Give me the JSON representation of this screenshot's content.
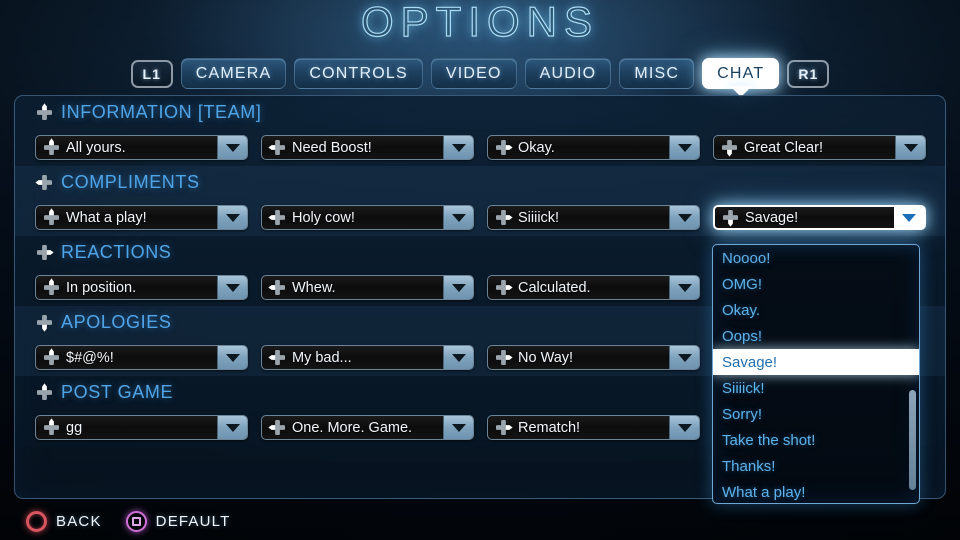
{
  "title": "OPTIONS",
  "tabbar": {
    "left_bumper": "L1",
    "right_bumper": "R1",
    "tabs": [
      {
        "label": "CAMERA",
        "active": false
      },
      {
        "label": "CONTROLS",
        "active": false
      },
      {
        "label": "VIDEO",
        "active": false
      },
      {
        "label": "AUDIO",
        "active": false
      },
      {
        "label": "MISC",
        "active": false
      },
      {
        "label": "CHAT",
        "active": true
      }
    ]
  },
  "colors": {
    "accent_blue": "#4fa5e8",
    "option_text": "#5fb3ec",
    "highlight_white": "#ffffff",
    "back_button": "#d9555f",
    "default_button": "#d070d8"
  },
  "sections": [
    {
      "title": "INFORMATION [TEAM]",
      "dpad": "dpad-up-icon",
      "items": [
        {
          "value": "All yours.",
          "dpad": "dpad-up-icon"
        },
        {
          "value": "Need Boost!",
          "dpad": "dpad-left-icon"
        },
        {
          "value": "Okay.",
          "dpad": "dpad-right-icon"
        },
        {
          "value": "Great Clear!",
          "dpad": "dpad-down-icon"
        }
      ]
    },
    {
      "title": "COMPLIMENTS",
      "dpad": "dpad-left-icon",
      "items": [
        {
          "value": "What a play!",
          "dpad": "dpad-up-icon"
        },
        {
          "value": "Holy cow!",
          "dpad": "dpad-left-icon"
        },
        {
          "value": "Siiiick!",
          "dpad": "dpad-right-icon"
        },
        {
          "value": "Savage!",
          "dpad": "dpad-down-icon",
          "focused": true
        }
      ]
    },
    {
      "title": "REACTIONS",
      "dpad": "dpad-right-icon",
      "items": [
        {
          "value": "In position.",
          "dpad": "dpad-up-icon"
        },
        {
          "value": "Whew.",
          "dpad": "dpad-left-icon"
        },
        {
          "value": "Calculated.",
          "dpad": "dpad-right-icon"
        }
      ]
    },
    {
      "title": "APOLOGIES",
      "dpad": "dpad-down-icon",
      "items": [
        {
          "value": "$#@%!",
          "dpad": "dpad-up-icon"
        },
        {
          "value": "My bad...",
          "dpad": "dpad-left-icon"
        },
        {
          "value": "No Way!",
          "dpad": "dpad-right-icon"
        }
      ]
    },
    {
      "title": "POST GAME",
      "dpad": "dpad-up-icon",
      "items": [
        {
          "value": "gg",
          "dpad": "dpad-up-icon"
        },
        {
          "value": "One. More. Game.",
          "dpad": "dpad-left-icon"
        },
        {
          "value": "Rematch!",
          "dpad": "dpad-right-icon"
        }
      ]
    }
  ],
  "open_dropdown": {
    "selected": "Savage!",
    "options": [
      "Noooo!",
      "OMG!",
      "Okay.",
      "Oops!",
      "Savage!",
      "Siiiick!",
      "Sorry!",
      "Take the shot!",
      "Thanks!",
      "What a play!"
    ]
  },
  "footer": {
    "buttons": [
      {
        "label": "BACK",
        "icon": "ps-circle-icon"
      },
      {
        "label": "DEFAULT",
        "icon": "ps-square-icon"
      }
    ]
  }
}
